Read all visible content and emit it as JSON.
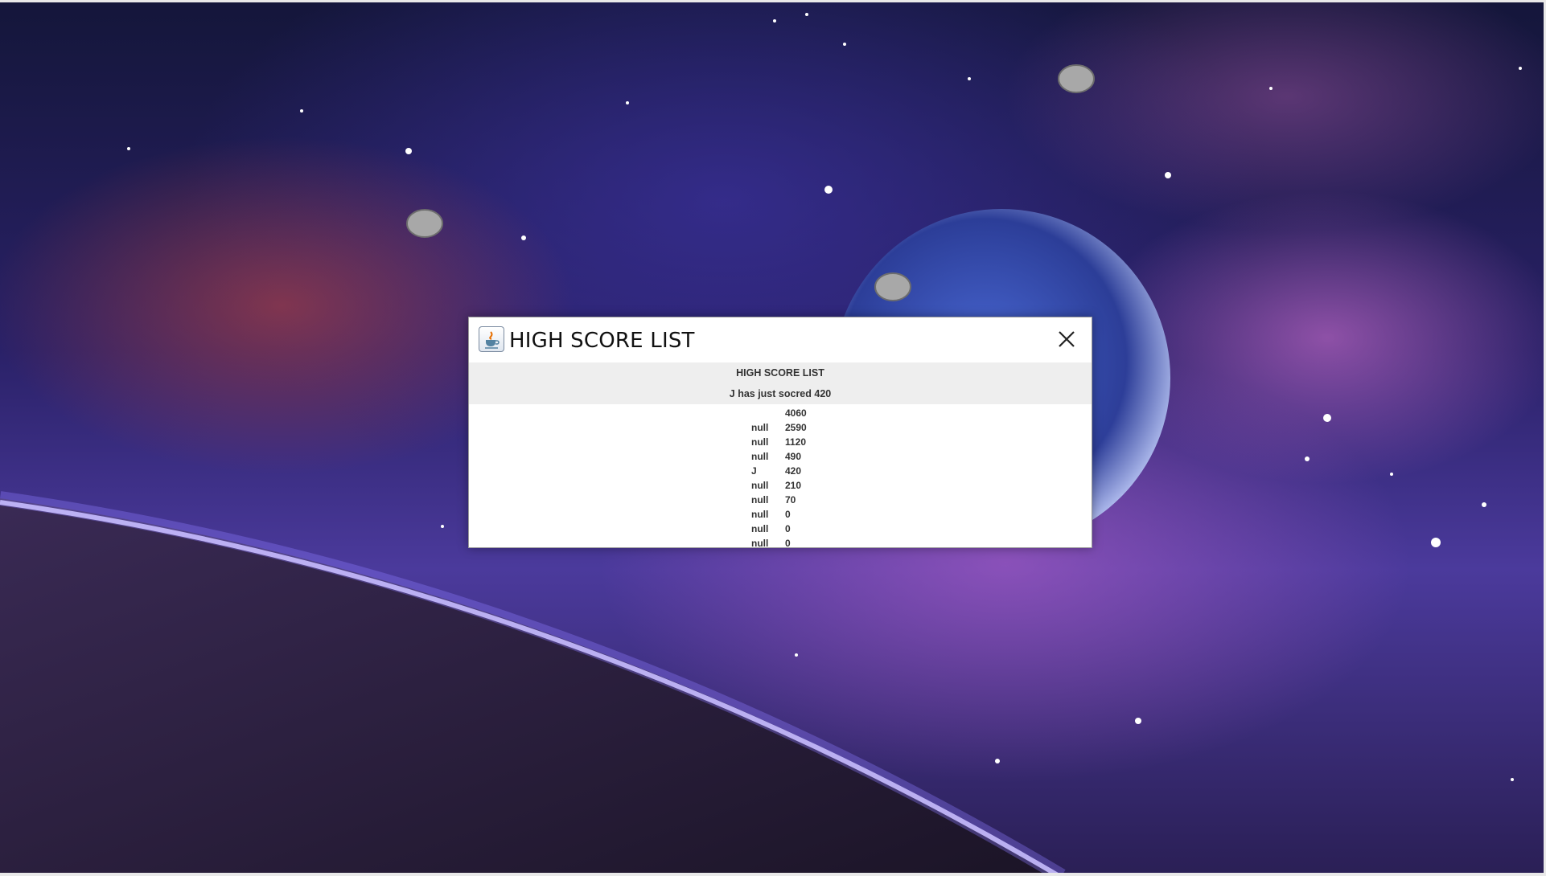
{
  "window": {
    "title": "HIGH SCORE LIST"
  },
  "dialog": {
    "heading": "HIGH SCORE LIST",
    "message": "J has just socred 420",
    "scores": [
      {
        "name": "",
        "score": "4060"
      },
      {
        "name": "null",
        "score": "2590"
      },
      {
        "name": "null",
        "score": "1120"
      },
      {
        "name": "null",
        "score": "490"
      },
      {
        "name": "J",
        "score": "420"
      },
      {
        "name": "null",
        "score": "210"
      },
      {
        "name": "null",
        "score": "70"
      },
      {
        "name": "null",
        "score": "0"
      },
      {
        "name": "null",
        "score": "0"
      },
      {
        "name": "null",
        "score": "0"
      }
    ]
  },
  "icons": {
    "app": "java-icon",
    "close": "close-icon"
  },
  "colors": {
    "dialog_background": "#ffffff",
    "header_background": "#eeeeee",
    "text": "#333333"
  }
}
